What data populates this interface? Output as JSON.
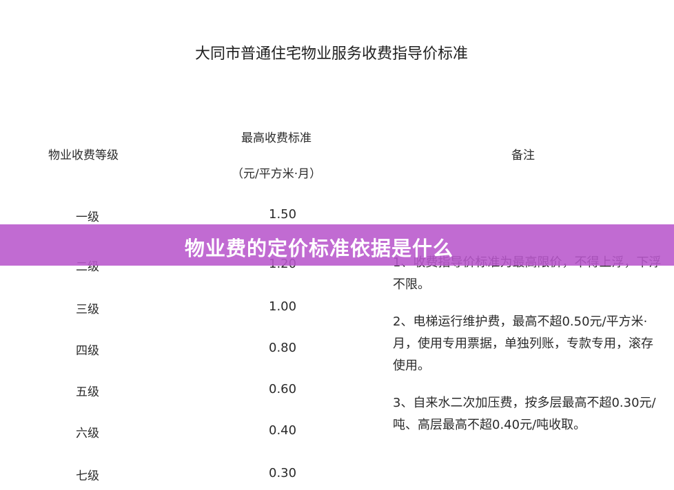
{
  "document": {
    "title": "大同市普通住宅物业服务收费指导价标准",
    "headers": {
      "level": "物业收费等级",
      "price_line1": "最高收费标准",
      "price_line2": "（元/平方米·月）",
      "note": "备注"
    },
    "rows": [
      {
        "level": "一级",
        "price": "1.50"
      },
      {
        "level": "二级",
        "price": "1.20"
      },
      {
        "level": "三级",
        "price": "1.00"
      },
      {
        "level": "四级",
        "price": "0.80"
      },
      {
        "level": "五级",
        "price": "0.60"
      },
      {
        "level": "六级",
        "price": "0.40"
      },
      {
        "level": "七级",
        "price": "0.30"
      }
    ],
    "notes": [
      "1、收费指导价标准为最高限价，不得上浮，下浮不限。",
      "2、电梯运行维护费，最高不超0.50元/平方米·月，使用专用票据，单独列账，专款专用，滚存使用。",
      "3、自来水二次加压费，按多层最高不超0.30元/吨、高层最高不超0.40元/吨收取。"
    ]
  },
  "banner": {
    "text": "物业费的定价标准依据是什么",
    "color": "#b856cc"
  }
}
